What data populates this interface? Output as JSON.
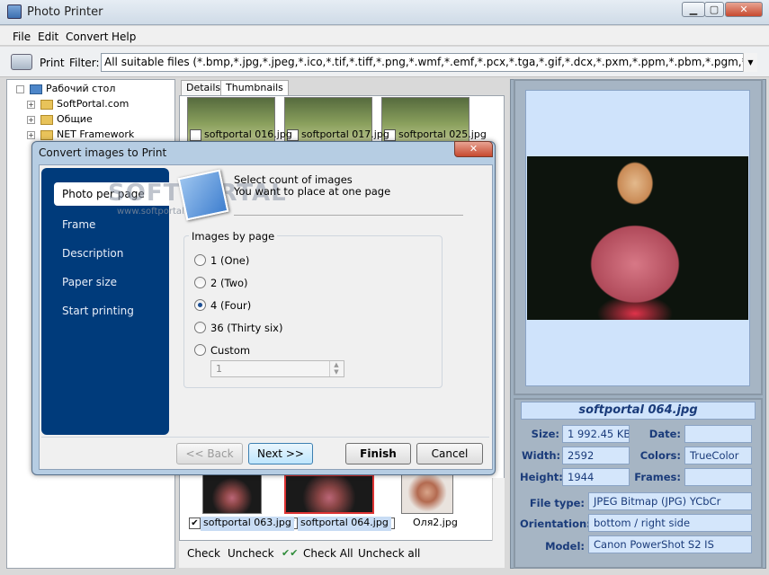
{
  "window": {
    "title": "Photo Printer",
    "min": "▁",
    "max": "▢",
    "close": "✕"
  },
  "menu": [
    "File",
    "Edit",
    "Convert",
    "Help"
  ],
  "toolbar": {
    "print_label": "Print",
    "filter_label": "Filter:",
    "filter_value": "All suitable files (*.bmp,*.jpg,*.jpeg,*.ico,*.tif,*.tiff,*.png,*.wmf,*.emf,*.pcx,*.tga,*.gif,*.dcx,*.pxm,*.ppm,*.pbm,*.pgm,*.pxm,*.j2k,*.jp2,*.",
    "dropdown_icon": "▼"
  },
  "tree": [
    {
      "label": "Рабочий стол",
      "expander": ""
    },
    {
      "label": "SoftPortal.com",
      "expander": "+"
    },
    {
      "label": "Общие",
      "expander": "+"
    },
    {
      "label": "NET Framework",
      "expander": "+"
    }
  ],
  "tabs": [
    "Details",
    "Thumbnails"
  ],
  "thumbnails_top": [
    "softportal 016.jpg",
    "softportal 017.jpg",
    "softportal 025.jpg"
  ],
  "thumbnails_bottom": [
    {
      "label": "softportal 063.jpg",
      "checked": true,
      "check": "✔"
    },
    {
      "label": "softportal 064.jpg",
      "checked": true,
      "check": "✔"
    },
    {
      "label": "Оля2.jpg",
      "checked": false,
      "check": ""
    }
  ],
  "bottom_actions": {
    "check": "Check",
    "uncheck": "Uncheck",
    "check_all": "Check All",
    "uncheck_all": "Uncheck all",
    "check_all_icon": "✔✔"
  },
  "info": {
    "filename": "softportal 064.jpg",
    "size_label": "Size:",
    "size": "1 992.45 KB",
    "date_label": "Date:",
    "date": "",
    "width_label": "Width:",
    "width": "2592",
    "colors_label": "Colors:",
    "colors": "TrueColor",
    "height_label": "Height:",
    "height": "1944",
    "frames_label": "Frames:",
    "frames": "",
    "filetype_label": "File type:",
    "filetype": "JPEG Bitmap (JPG) YCbCr",
    "orientation_label": "Orientation:",
    "orientation": "bottom / right side",
    "model_label": "Model:",
    "model": "Canon PowerShot S2 IS"
  },
  "dialog": {
    "title": "Convert images to Print",
    "close": "✕",
    "nav": [
      "Photo per page",
      "Frame",
      "Description",
      "Paper size",
      "Start printing"
    ],
    "header_line1": "Select count of images",
    "header_line2": "You want to place at one page",
    "watermark_big": "SOFTPORTAL",
    "watermark_small": "www.softportal.com",
    "group_title": "Images by page",
    "options": [
      "1 (One)",
      "2 (Two)",
      "4 (Four)",
      "36 (Thirty six)",
      "Custom"
    ],
    "selected_option": "4 (Four)",
    "custom_value": "1",
    "buttons": {
      "back": "<< Back",
      "next": "Next >>",
      "finish": "Finish",
      "cancel": "Cancel"
    }
  }
}
